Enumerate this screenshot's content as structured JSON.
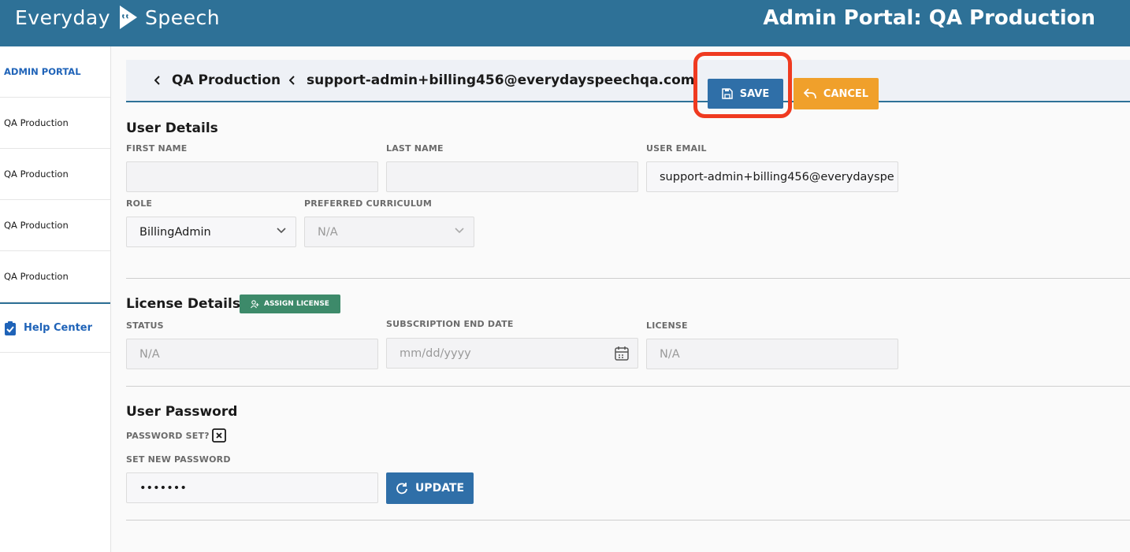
{
  "header": {
    "logo_word1": "Everyday",
    "logo_word2": "Speech",
    "title": "Admin Portal: QA Production"
  },
  "sidebar": {
    "heading": "ADMIN PORTAL",
    "items": [
      {
        "label": "QA Production"
      },
      {
        "label": "QA Production"
      },
      {
        "label": "QA Production"
      },
      {
        "label": "QA Production"
      }
    ],
    "help_label": "Help Center"
  },
  "breadcrumb": {
    "parent": "QA Production",
    "current": "support-admin+billing456@everydayspeechqa.com"
  },
  "actions": {
    "save_label": "SAVE",
    "cancel_label": "CANCEL"
  },
  "user_details": {
    "title": "User Details",
    "first_name_label": "FIRST NAME",
    "first_name_value": "",
    "last_name_label": "LAST NAME",
    "last_name_value": "",
    "email_label": "USER EMAIL",
    "email_value": "support-admin+billing456@everydayspe",
    "role_label": "ROLE",
    "role_value": "BillingAdmin",
    "curriculum_label": "PREFERRED CURRICULUM",
    "curriculum_value": "N/A"
  },
  "license_details": {
    "title": "License Details",
    "assign_label": "ASSIGN LICENSE",
    "status_label": "STATUS",
    "status_value": "N/A",
    "end_date_label": "SUBSCRIPTION END DATE",
    "end_date_placeholder": "mm/dd/yyyy",
    "license_label": "LICENSE",
    "license_value": "N/A"
  },
  "user_password": {
    "title": "User Password",
    "password_set_label": "PASSWORD SET?",
    "new_password_label": "SET NEW PASSWORD",
    "new_password_value": "•••••••",
    "update_label": "UPDATE"
  },
  "colors": {
    "header_bg": "#2e7197",
    "save": "#2f6fa8",
    "cancel": "#f0a02b",
    "assign": "#3d8a6a",
    "highlight": "#ef3a20"
  }
}
